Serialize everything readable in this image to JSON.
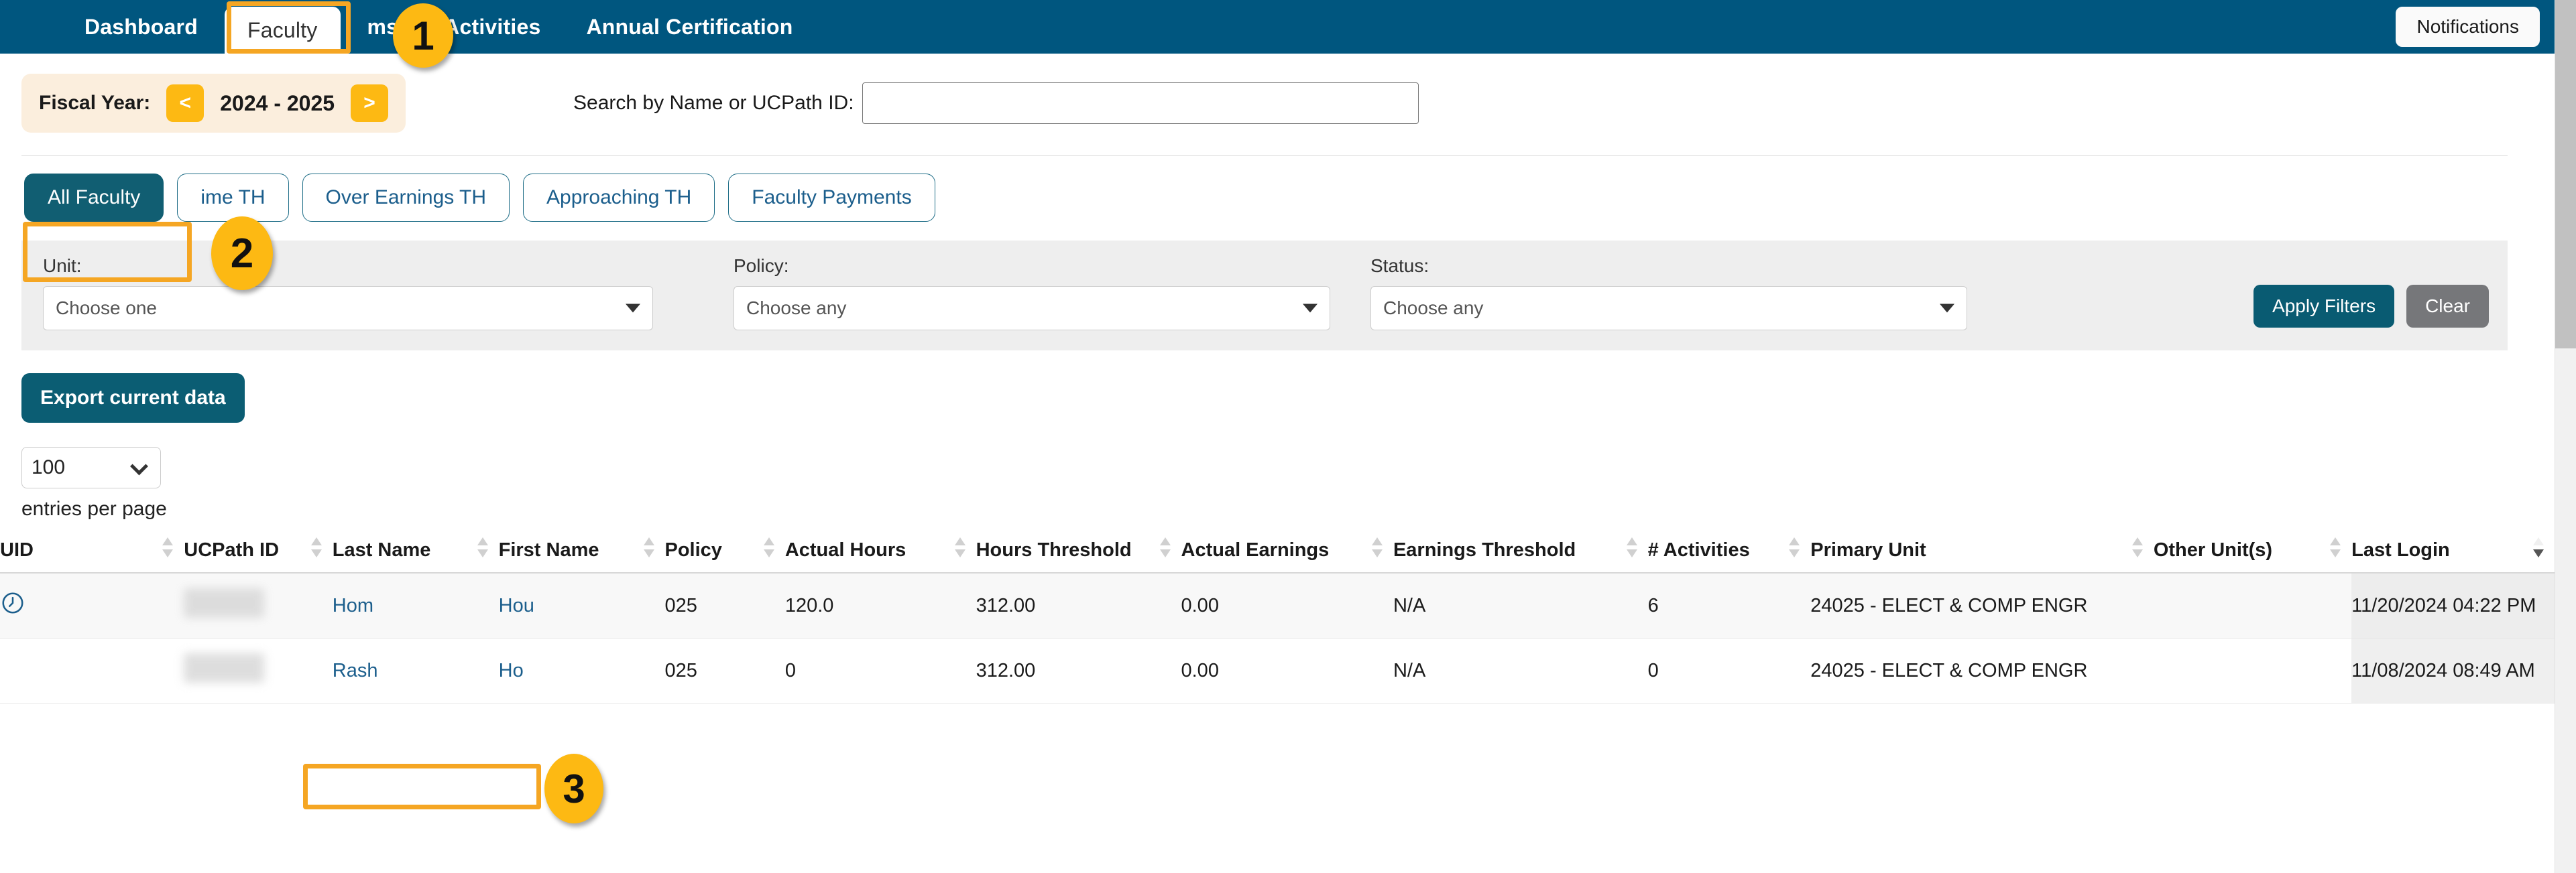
{
  "topnav": {
    "items": [
      {
        "label": "Dashboard",
        "active": false
      },
      {
        "label": "Faculty",
        "active": true
      },
      {
        "label": "ms",
        "active": false
      },
      {
        "label": "Activities",
        "active": false
      },
      {
        "label": "Annual Certification",
        "active": false
      }
    ],
    "notifications_label": "Notifications",
    "bg_color": "#00567f"
  },
  "fiscal_year": {
    "label": "Fiscal Year:",
    "prev_label": "<",
    "next_label": ">",
    "value": "2024 - 2025"
  },
  "search": {
    "label": "Search by Name or UCPath ID:",
    "value": "",
    "placeholder": ""
  },
  "subtabs": [
    {
      "label": "All Faculty",
      "active": true
    },
    {
      "label": "ime TH",
      "active": false
    },
    {
      "label": "Over Earnings TH",
      "active": false
    },
    {
      "label": "Approaching TH",
      "active": false
    },
    {
      "label": "Faculty Payments",
      "active": false
    }
  ],
  "filters": {
    "unit": {
      "label": "Unit:",
      "value": "Choose one"
    },
    "policy": {
      "label": "Policy:",
      "value": "Choose any"
    },
    "status": {
      "label": "Status:",
      "value": "Choose any"
    },
    "apply_label": "Apply Filters",
    "clear_label": "Clear"
  },
  "export": {
    "label": "Export current data"
  },
  "pagination": {
    "entries_value": "100",
    "entries_label": "entries per page"
  },
  "table": {
    "columns": [
      {
        "label": "UID",
        "sortable": true,
        "sort": "none"
      },
      {
        "label": "UCPath ID",
        "sortable": true,
        "sort": "none"
      },
      {
        "label": "Last Name",
        "sortable": true,
        "sort": "none"
      },
      {
        "label": "First Name",
        "sortable": true,
        "sort": "none"
      },
      {
        "label": "Policy",
        "sortable": true,
        "sort": "none"
      },
      {
        "label": "Actual Hours",
        "sortable": true,
        "sort": "none"
      },
      {
        "label": "Hours Threshold",
        "sortable": true,
        "sort": "none"
      },
      {
        "label": "Actual Earnings",
        "sortable": true,
        "sort": "none"
      },
      {
        "label": "Earnings Threshold",
        "sortable": true,
        "sort": "none"
      },
      {
        "label": "# Activities",
        "sortable": true,
        "sort": "none"
      },
      {
        "label": "Primary Unit",
        "sortable": true,
        "sort": "none"
      },
      {
        "label": "Other Unit(s)",
        "sortable": true,
        "sort": "none"
      },
      {
        "label": "Last Login",
        "sortable": true,
        "sort": "desc"
      }
    ],
    "rows": [
      {
        "uid_icon": "clock-history-icon",
        "ucpath_id": "",
        "last_name": "Hom",
        "first_name": "Hou",
        "policy": "025",
        "actual_hours": "120.0",
        "hours_threshold": "312.00",
        "actual_earnings": "0.00",
        "earnings_threshold": "N/A",
        "num_activities": "6",
        "primary_unit": "24025 - ELECT & COMP ENGR",
        "other_units": "",
        "last_login": "11/20/2024 04:22 PM"
      },
      {
        "uid_icon": "",
        "ucpath_id": "",
        "last_name": "Rash",
        "first_name": "Ho",
        "policy": "025",
        "actual_hours": "0",
        "hours_threshold": "312.00",
        "actual_earnings": "0.00",
        "earnings_threshold": "N/A",
        "num_activities": "0",
        "primary_unit": "24025 - ELECT & COMP ENGR",
        "other_units": "",
        "last_login": "11/08/2024 08:49 AM"
      }
    ]
  },
  "annotations": {
    "accent_color": "#fdb913",
    "callouts": [
      {
        "number": "1"
      },
      {
        "number": "2"
      },
      {
        "number": "3"
      }
    ]
  }
}
